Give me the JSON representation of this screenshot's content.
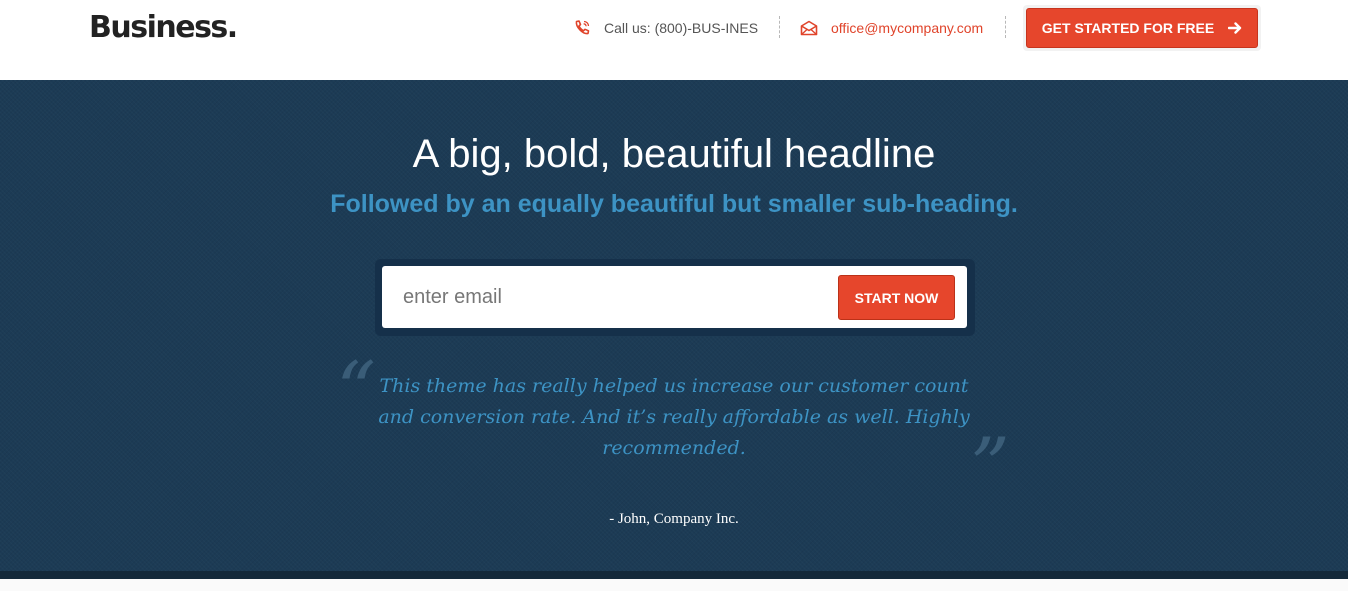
{
  "header": {
    "logo": "Business.",
    "phone": "Call us: (800)-BUS-INES",
    "email": "office@mycompany.com",
    "cta_label": "GET STARTED FOR FREE"
  },
  "hero": {
    "headline": "A big, bold, beautiful headline",
    "subheading": "Followed by an equally beautiful but smaller sub-heading.",
    "email_placeholder": "enter email",
    "start_label": "START NOW",
    "quote_open": "“",
    "quote_close": "”",
    "testimonial": "This theme has really helped us increase our customer count and conversion rate. And it’s really affordable as well. Highly recommended.",
    "author": "- John, Company Inc."
  },
  "icons": {
    "phone": "phone-icon",
    "mail": "envelope-icon",
    "arrow": "arrow-right-icon"
  },
  "colors": {
    "accent": "#e6462c",
    "hero_bg": "#1c3b55",
    "subheading": "#3d93c4"
  }
}
